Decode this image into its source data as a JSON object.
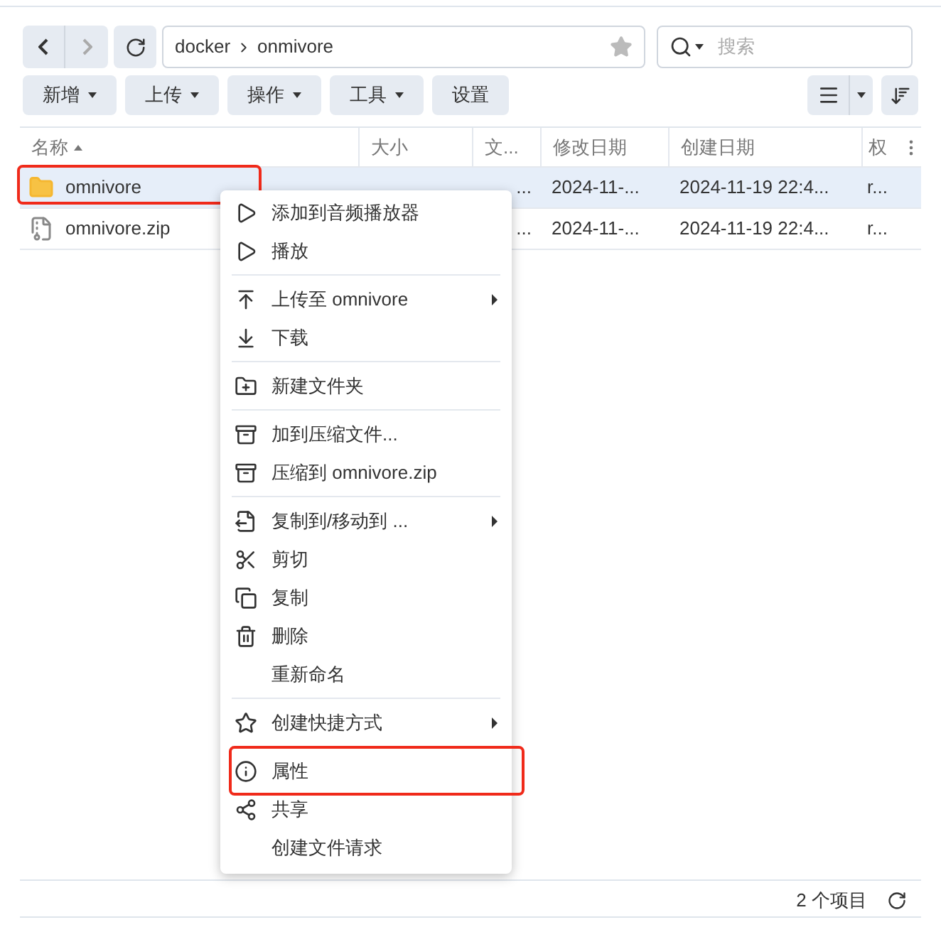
{
  "path": {
    "segments": [
      "docker",
      "onmivore"
    ]
  },
  "search": {
    "placeholder": "搜索"
  },
  "toolbar": [
    {
      "label": "新增",
      "dropdown": true
    },
    {
      "label": "上传",
      "dropdown": true
    },
    {
      "label": "操作",
      "dropdown": true
    },
    {
      "label": "工具",
      "dropdown": true
    },
    {
      "label": "设置",
      "dropdown": false
    }
  ],
  "table": {
    "columns": [
      {
        "label": "名称",
        "sorted": true
      },
      {
        "label": "大小",
        "sorted": false
      },
      {
        "label": "文...",
        "sorted": false
      },
      {
        "label": "修改日期",
        "sorted": false
      },
      {
        "label": "创建日期",
        "sorted": false
      },
      {
        "label": "权",
        "sorted": false
      }
    ],
    "rows": [
      {
        "kind": "folder",
        "name": "omnivore",
        "type": "...",
        "modified": "2024-11-...",
        "created": "2024-11-19 22:4...",
        "perm": "r...",
        "selected": true,
        "highlighted": true
      },
      {
        "kind": "zip",
        "name": "omnivore.zip",
        "type": "...",
        "modified": "2024-11-...",
        "created": "2024-11-19 22:4...",
        "perm": "r...",
        "selected": false,
        "highlighted": false
      }
    ]
  },
  "context_menu": [
    [
      {
        "kind": "play",
        "label": "添加到音频播放器",
        "submenu": false,
        "highlighted": false
      },
      {
        "kind": "play",
        "label": "播放",
        "submenu": false,
        "highlighted": false
      }
    ],
    [
      {
        "kind": "upload",
        "label": "上传至 omnivore",
        "submenu": true,
        "highlighted": false
      },
      {
        "kind": "download",
        "label": "下载",
        "submenu": false,
        "highlighted": false
      }
    ],
    [
      {
        "kind": "newfolder",
        "label": "新建文件夹",
        "submenu": false,
        "highlighted": false
      }
    ],
    [
      {
        "kind": "archive",
        "label": "加到压缩文件...",
        "submenu": false,
        "highlighted": false
      },
      {
        "kind": "archive",
        "label": "压缩到 omnivore.zip",
        "submenu": false,
        "highlighted": false
      }
    ],
    [
      {
        "kind": "copymove",
        "label": "复制到/移动到 ...",
        "submenu": true,
        "highlighted": false
      },
      {
        "kind": "cut",
        "label": "剪切",
        "submenu": false,
        "highlighted": false
      },
      {
        "kind": "copy",
        "label": "复制",
        "submenu": false,
        "highlighted": false
      },
      {
        "kind": "delete",
        "label": "删除",
        "submenu": false,
        "highlighted": false
      },
      {
        "kind": "plain",
        "label": "重新命名",
        "submenu": false,
        "highlighted": false
      }
    ],
    [
      {
        "kind": "star",
        "label": "创建快捷方式",
        "submenu": true,
        "highlighted": false
      }
    ],
    [
      {
        "kind": "info",
        "label": "属性",
        "submenu": false,
        "highlighted": true
      },
      {
        "kind": "share",
        "label": "共享",
        "submenu": false,
        "highlighted": false
      },
      {
        "kind": "plain",
        "label": "创建文件请求",
        "submenu": false,
        "highlighted": false
      }
    ]
  ],
  "status_bar": {
    "count": "2 个项目"
  }
}
